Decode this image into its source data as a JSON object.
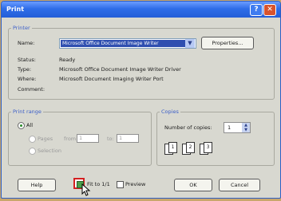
{
  "window": {
    "title": "Print"
  },
  "printer": {
    "group_title": "Printer",
    "name_label": "Name:",
    "selected": "Microsoft Office Document Image Writer",
    "properties_label": "Properties...",
    "status_label": "Status:",
    "status_value": "Ready",
    "type_label": "Type:",
    "type_value": "Microsoft Office Document Image Writer Driver",
    "where_label": "Where:",
    "where_value": "Microsoft Document Imaging Writer Port",
    "comment_label": "Comment:"
  },
  "print_range": {
    "group_title": "Print range",
    "all_label": "All",
    "pages_label": "Pages",
    "from_label": "from:",
    "from_value": "1",
    "to_label": "to:",
    "to_value": "1",
    "selection_label": "Selection"
  },
  "copies": {
    "group_title": "Copies",
    "number_label": "Number of copies:",
    "number_value": "1",
    "collate_pages": [
      "1",
      "2",
      "3"
    ]
  },
  "bottom": {
    "help_label": "Help",
    "fit_label": "Fit to 1/1",
    "preview_label": "Preview",
    "ok_label": "OK",
    "cancel_label": "Cancel"
  }
}
